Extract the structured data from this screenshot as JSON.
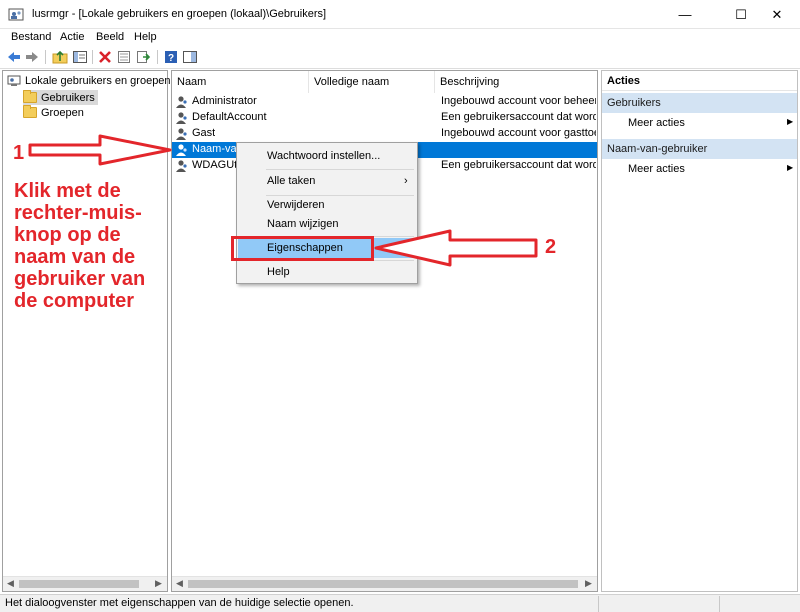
{
  "window": {
    "title": "lusrmgr - [Lokale gebruikers en groepen (lokaal)\\Gebruikers]",
    "min_glyph": "—",
    "max_glyph": "☐",
    "close_glyph": "✕"
  },
  "menu": [
    "Bestand",
    "Actie",
    "Beeld",
    "Help"
  ],
  "toolbar_icons": [
    "back-icon",
    "forward-icon",
    "up-folder-icon",
    "show-hide-tree-icon",
    "delete-icon",
    "properties-icon",
    "export-icon",
    "help-icon",
    "panel-icon"
  ],
  "tree": {
    "root": "Lokale gebruikers en groepen (lo",
    "items": [
      "Gebruikers",
      "Groepen"
    ]
  },
  "list": {
    "columns": [
      "Naam",
      "Volledige naam",
      "Beschrijving"
    ],
    "rows": [
      {
        "name": "Administrator",
        "full": "",
        "desc": "Ingebouwd account voor beheer ..."
      },
      {
        "name": "DefaultAccount",
        "full": "",
        "desc": "Een gebruikersaccount dat wordt ..."
      },
      {
        "name": "Gast",
        "full": "",
        "desc": "Ingebouwd account voor gasttoe..."
      },
      {
        "name": "Naam-va",
        "full": "",
        "desc": ""
      },
      {
        "name": "WDAGUtil",
        "full": "",
        "desc": "Een gebruikersaccount dat wordt ..."
      }
    ]
  },
  "actions": {
    "title": "Acties",
    "sections": [
      {
        "header": "Gebruikers",
        "item": "Meer acties"
      },
      {
        "header": "Naam-van-gebruiker",
        "item": "Meer acties"
      }
    ]
  },
  "context_menu": {
    "items": [
      "Wachtwoord instellen...",
      "Alle taken",
      "Verwijderen",
      "Naam wijzigen",
      "Eigenschappen",
      "Help"
    ],
    "submenu_glyph": "›"
  },
  "status": {
    "text": "Het dialoogvenster met eigenschappen van de huidige selectie openen."
  },
  "annotations": {
    "num1": "1",
    "num2": "2",
    "instruction": "Klik met de rechter-muis-knop op de naam van de gebruiker van de computer",
    "color": "#e3262b"
  }
}
